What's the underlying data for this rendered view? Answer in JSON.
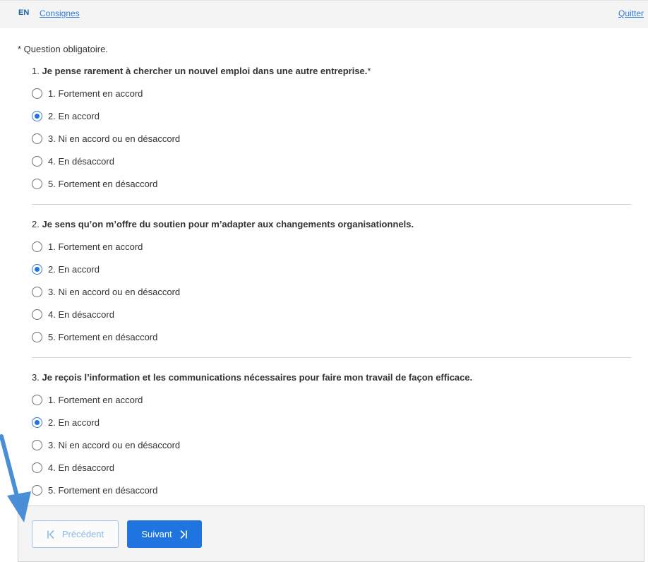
{
  "header": {
    "lang": "EN",
    "instructions_link": "Consignes",
    "quit_link": "Quitter"
  },
  "required_note": "* Question obligatoire.",
  "questions": [
    {
      "number": "1.",
      "text": "Je pense rarement à chercher un nouvel emploi dans une autre entreprise.",
      "required_mark": "*",
      "options": [
        "1. Fortement en accord",
        "2. En accord",
        "3. Ni en accord ou en désaccord",
        "4. En désaccord",
        "5. Fortement en désaccord"
      ],
      "selected": "2. En accord"
    },
    {
      "number": "2.",
      "text": "Je sens qu’on m’offre du soutien pour m’adapter aux changements organisationnels.",
      "required_mark": "",
      "options": [
        "1. Fortement en accord",
        "2. En accord",
        "3. Ni en accord ou en désaccord",
        "4. En désaccord",
        "5. Fortement en désaccord"
      ],
      "selected": "2. En accord"
    },
    {
      "number": "3.",
      "text": "Je reçois l’information et les communications nécessaires pour faire mon travail de façon efficace.",
      "required_mark": "",
      "options": [
        "1. Fortement en accord",
        "2. En accord",
        "3. Ni en accord ou en désaccord",
        "4. En désaccord",
        "5. Fortement en désaccord"
      ],
      "selected": "2. En accord"
    }
  ],
  "footer": {
    "prev_label": "Précédent",
    "next_label": "Suivant"
  },
  "icons": {
    "prev": "skip-previous-icon",
    "next": "skip-next-icon"
  },
  "colors": {
    "accent": "#1f74e0",
    "link": "#2f7bd6",
    "annotation_arrow": "#4a8fd6"
  }
}
